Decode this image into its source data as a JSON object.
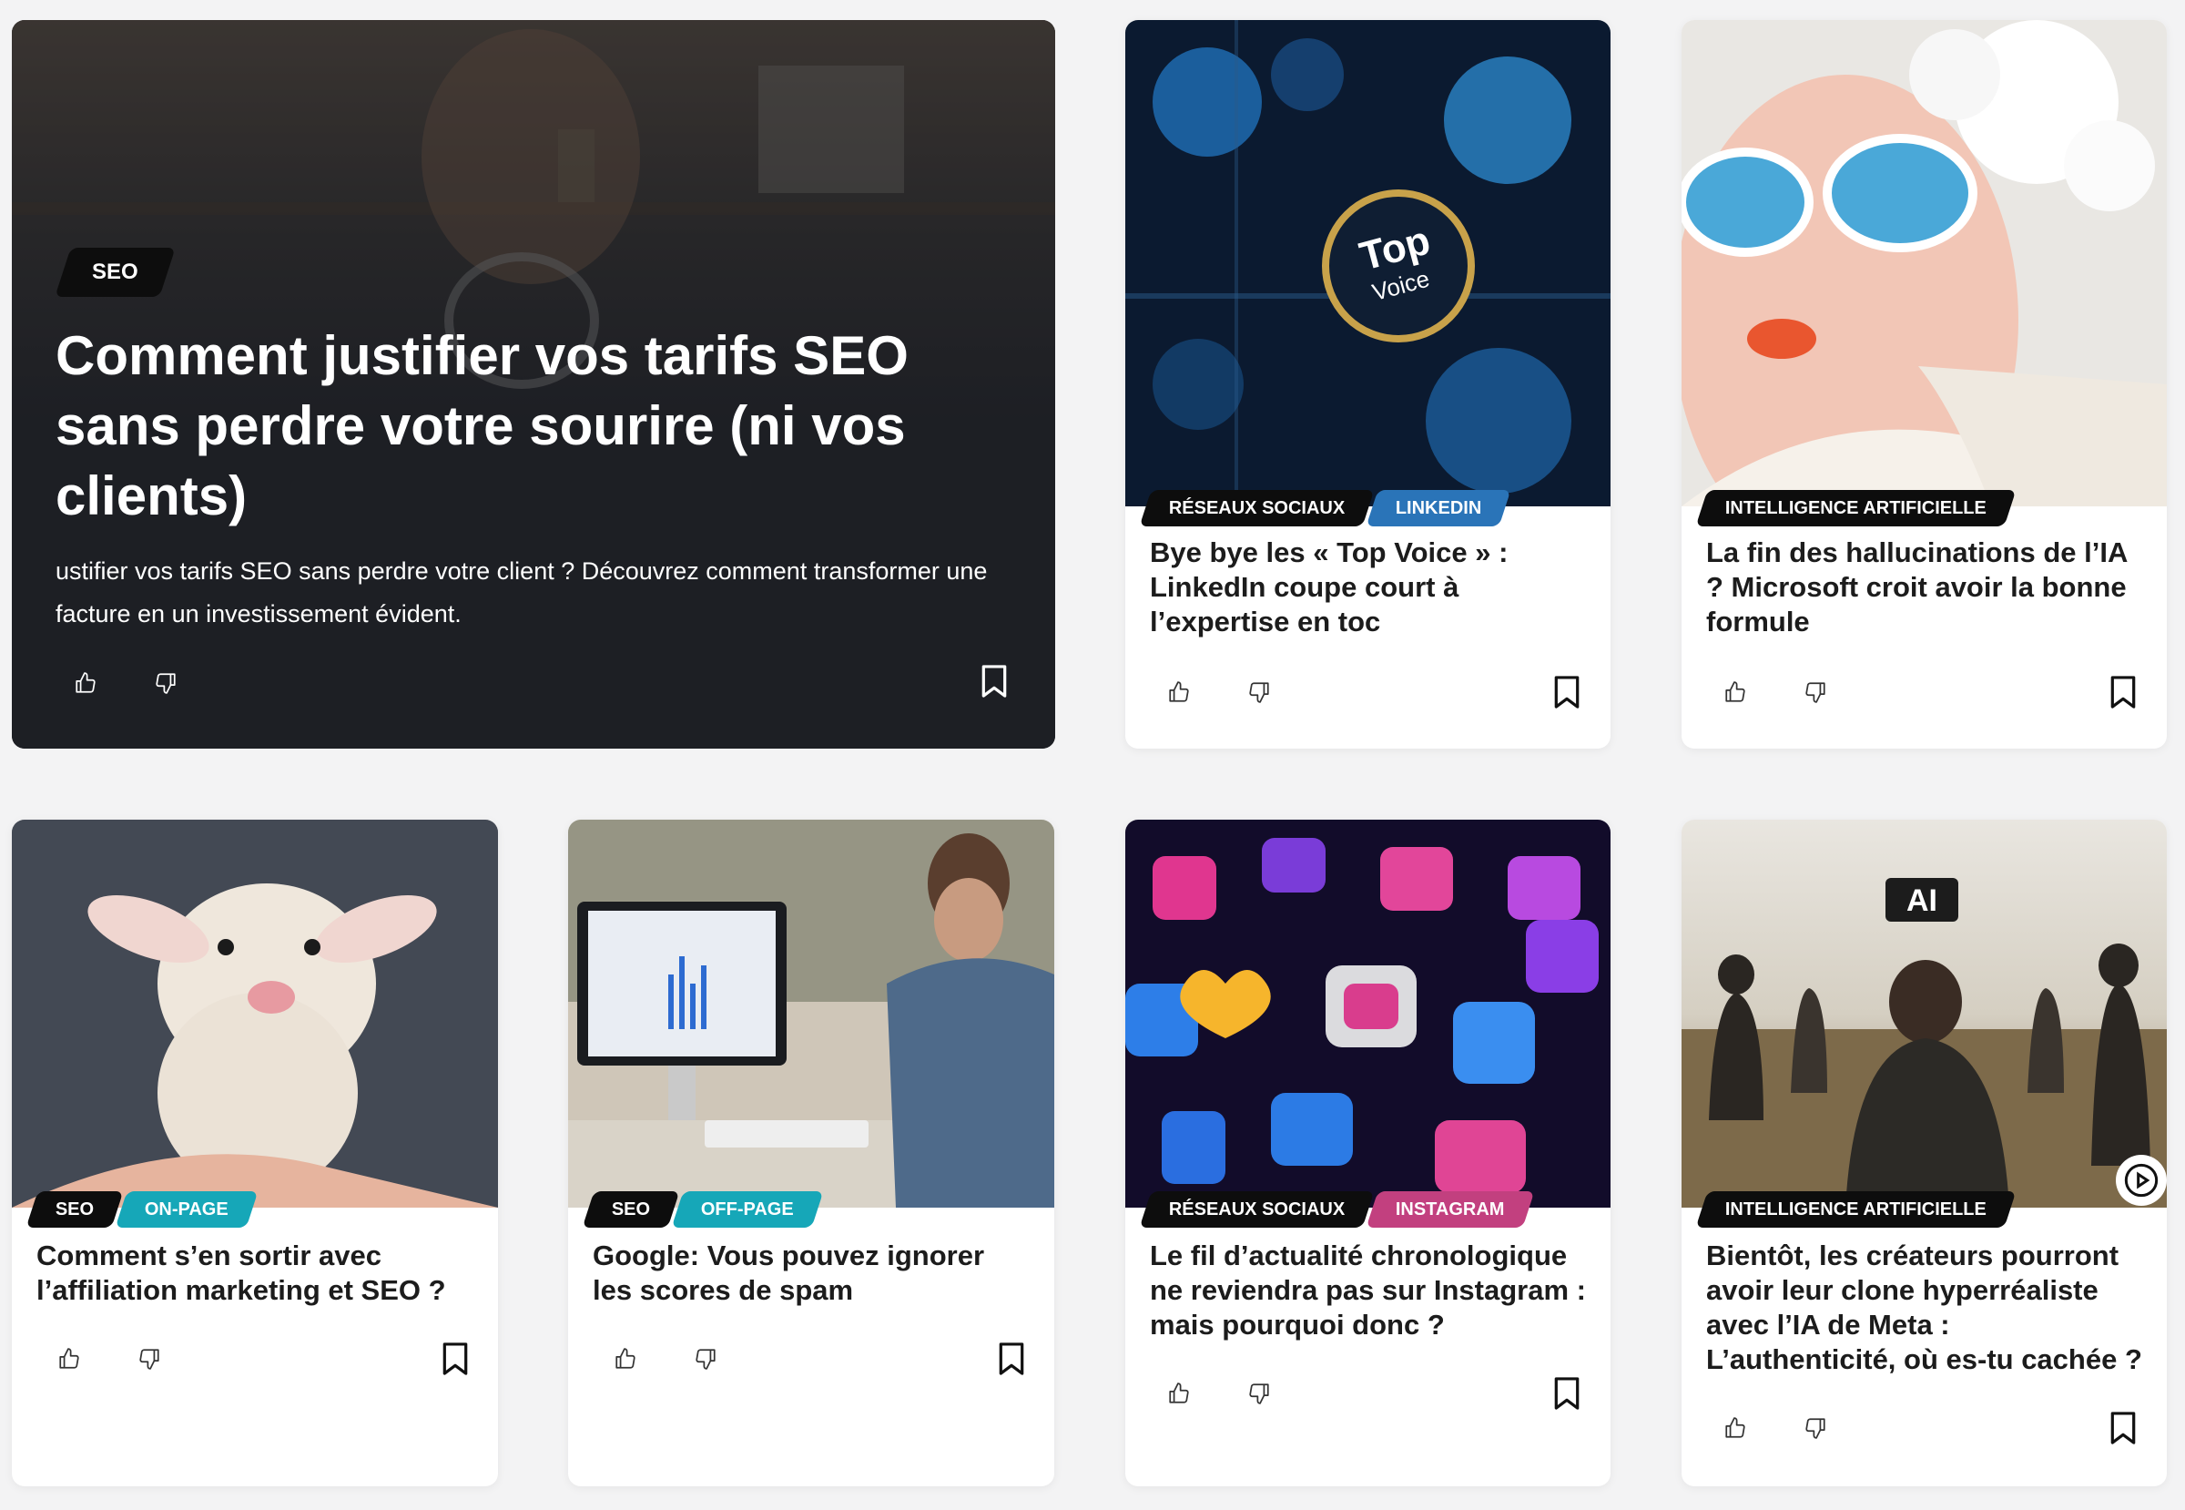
{
  "hero": {
    "tag": "SEO",
    "title": "Comment justifier vos tarifs SEO sans perdre votre sourire (ni vos clients)",
    "description": "ustifier vos tarifs SEO sans perdre votre client ? Découvrez comment transformer une facture en un investissement évident.",
    "image": "man-with-magnifying-glass"
  },
  "cards": [
    {
      "tags": [
        {
          "label": "RÉSEAUX SOCIAUX",
          "color": "#0d0d0d"
        },
        {
          "label": "LINKEDIN",
          "color": "#2a74b8"
        }
      ],
      "title": "Bye bye les « Top Voice » : LinkedIn coupe court à l’expertise en toc",
      "image": "top-voice-keyboard",
      "image_text": [
        "Top",
        "Voice"
      ]
    },
    {
      "tags": [
        {
          "label": "INTELLIGENCE ARTIFICIELLE",
          "color": "#0d0d0d"
        }
      ],
      "title": "La fin des hallucinations de l’IA ? Microsoft croit avoir la bonne formule",
      "image": "woman-with-snowflake-glasses"
    },
    {
      "tags": [
        {
          "label": "SEO",
          "color": "#0d0d0d"
        },
        {
          "label": "ON-PAGE",
          "color": "#16a7b8"
        }
      ],
      "title": "Comment s’en sortir avec l’affiliation marketing et SEO ?",
      "image": "smiling-lamb"
    },
    {
      "tags": [
        {
          "label": "SEO",
          "color": "#0d0d0d"
        },
        {
          "label": "OFF-PAGE",
          "color": "#16a7b8"
        }
      ],
      "title": "Google: Vous pouvez ignorer les scores de spam",
      "image": "man-at-computer"
    },
    {
      "tags": [
        {
          "label": "RÉSEAUX SOCIAUX",
          "color": "#0d0d0d"
        },
        {
          "label": "INSTAGRAM",
          "color": "#c2407f"
        }
      ],
      "title": "Le fil d’actualité chronologique ne reviendra pas sur Instagram : mais pourquoi donc ?",
      "image": "neon-social-icons"
    },
    {
      "tags": [
        {
          "label": "INTELLIGENCE ARTIFICIELLE",
          "color": "#0d0d0d"
        }
      ],
      "title": "Bientôt, les créateurs pourront avoir leur clone hyperréaliste avec l’IA de Meta : L’authenticité, où es-tu cachée ?",
      "image": "people-walking-ai-sign",
      "image_text": "AI",
      "video_icon": "play-circle-icon"
    }
  ],
  "icons": {
    "like": "thumbs-up-icon",
    "dislike": "thumbs-down-icon",
    "save": "bookmark-icon"
  }
}
